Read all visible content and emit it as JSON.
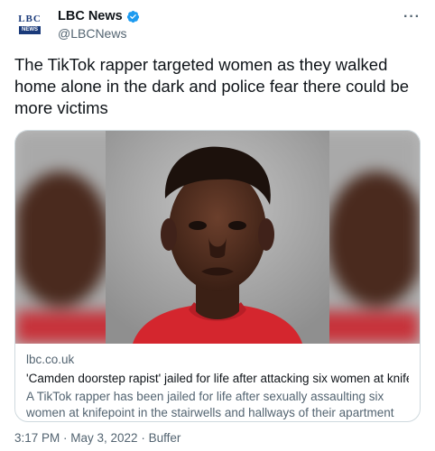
{
  "account": {
    "display_name": "LBC News",
    "handle": "@LBCNews",
    "logo_top": "LBC",
    "logo_bottom": "NEWS",
    "verified_icon": "verified-badge-icon",
    "more_label": "···"
  },
  "tweet": {
    "text": "The TikTok rapper targeted women as they walked home alone in the dark and police fear there could be more victims"
  },
  "card": {
    "domain": "lbc.co.uk",
    "title": "'Camden doorstep rapist' jailed for life after attacking six women at knifepoint",
    "description": "A TikTok rapper has been jailed for life after sexually assaulting six women at knifepoint in the stairwells and hallways of their apartment buildings in North ..."
  },
  "footer": {
    "meta": "3:17 PM · May 3, 2022 · Buffer"
  },
  "colors": {
    "accent": "#1d9bf0",
    "text": "#0f1419",
    "secondary": "#536471",
    "border": "#cfd9de",
    "shirt_red": "#d4262e"
  }
}
